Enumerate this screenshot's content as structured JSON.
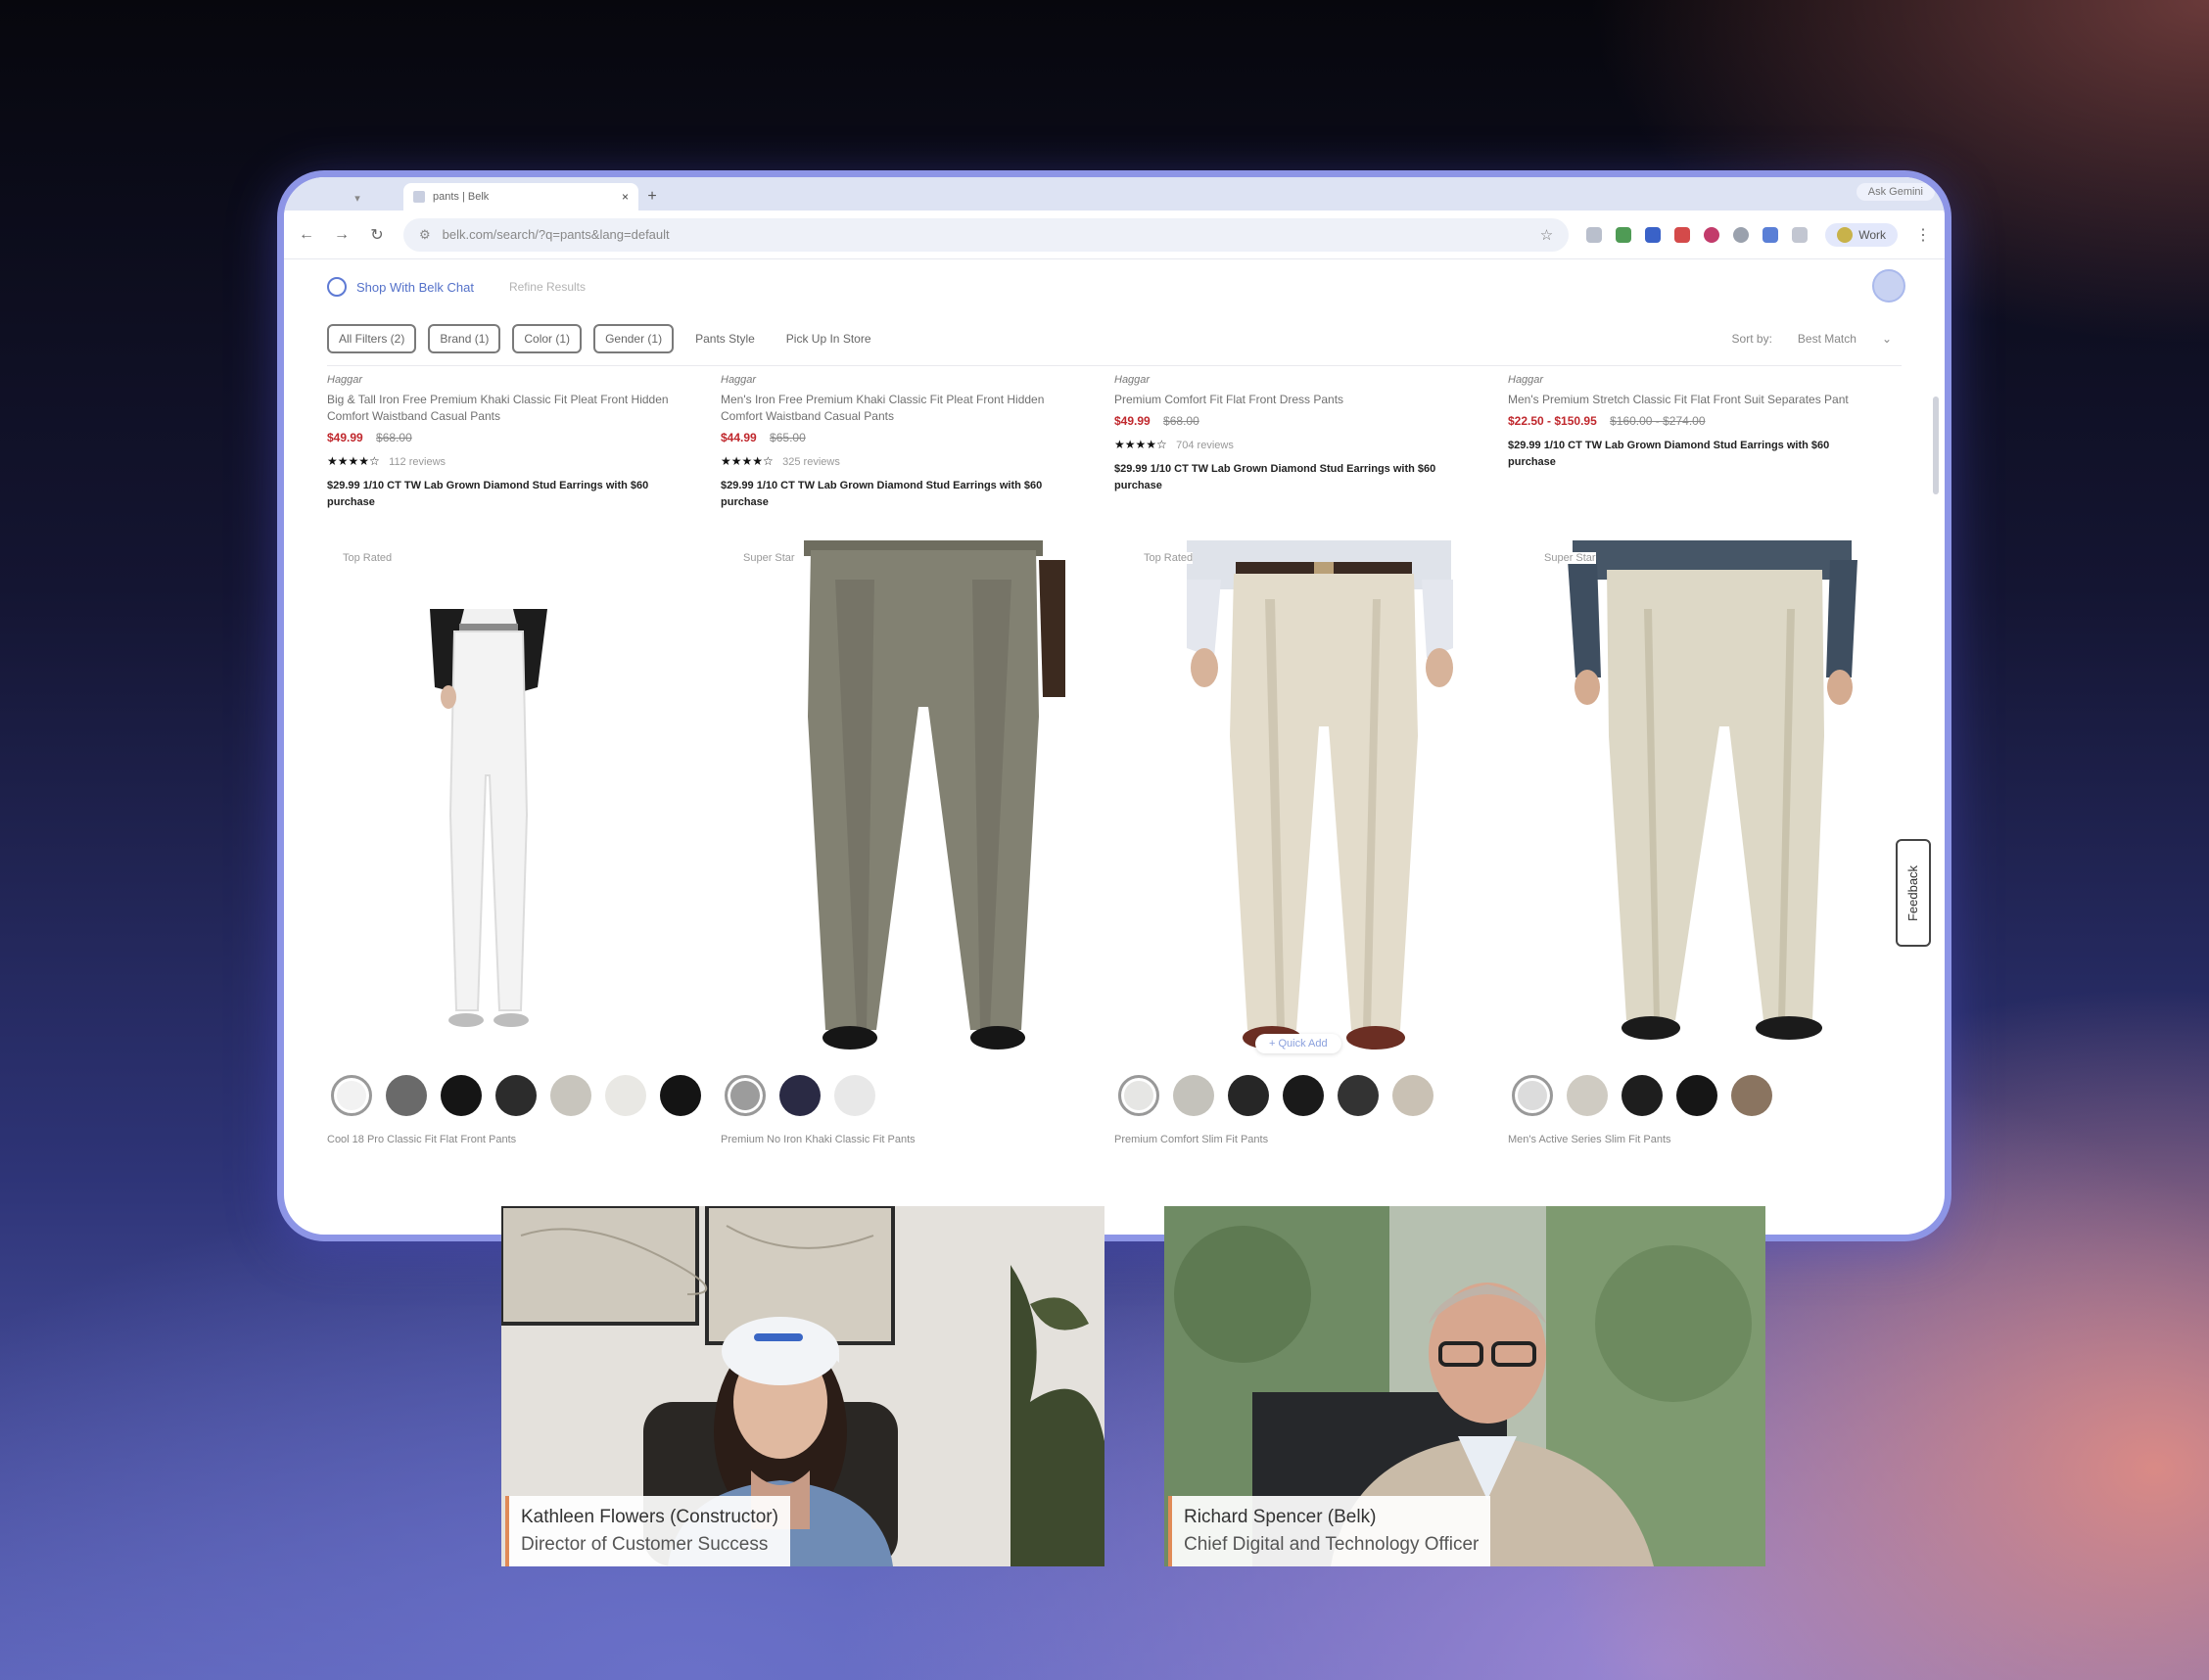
{
  "browser": {
    "tab_title": "pants | Belk",
    "tab_right": "Ask Gemini",
    "url": "belk.com/search/?q=pants&lang=default",
    "profile_label": "Work"
  },
  "page": {
    "shop_chat_label": "Shop With Belk Chat",
    "refine_label": "Refine Results",
    "filters": [
      "All Filters (2)",
      "Brand (1)",
      "Color (1)",
      "Gender (1)"
    ],
    "filters_plain": [
      "Pants Style",
      "Pick Up In Store"
    ],
    "sort_label": "Sort by:",
    "sort_value": "Best Match",
    "feedback_label": "Feedback"
  },
  "products": [
    {
      "brand": "Haggar",
      "name": "Big & Tall Iron Free Premium Khaki Classic Fit Pleat Front Hidden Comfort Waistband Casual Pants",
      "sale_price": "$49.99",
      "orig_price": "$68.00",
      "stars": "★★★★☆",
      "review_count": "112 reviews",
      "promo": "$29.99 1/10 CT TW Lab Grown Diamond Stud Earrings with $60 purchase",
      "badge": "Top Rated",
      "quick_add": "",
      "next_name": "Cool 18 Pro Classic Fit Flat Front Pants"
    },
    {
      "brand": "Haggar",
      "name": "Men's Iron Free Premium Khaki Classic Fit Pleat Front Hidden Comfort Waistband Casual Pants",
      "sale_price": "$44.99",
      "orig_price": "$65.00",
      "stars": "★★★★☆",
      "review_count": "325 reviews",
      "promo": "$29.99 1/10 CT TW Lab Grown Diamond Stud Earrings with $60 purchase",
      "badge": "Super Star",
      "quick_add": "",
      "next_name": "Premium No Iron Khaki Classic Fit Pants"
    },
    {
      "brand": "Haggar",
      "name": "Premium Comfort Fit Flat Front Dress Pants",
      "sale_price": "$49.99",
      "orig_price": "$68.00",
      "stars": "★★★★☆",
      "review_count": "704 reviews",
      "promo": "$29.99 1/10 CT TW Lab Grown Diamond Stud Earrings with $60 purchase",
      "badge": "Top Rated",
      "quick_add": "+ Quick Add",
      "next_name": "Premium Comfort Slim Fit Pants"
    },
    {
      "brand": "Haggar",
      "name": "Men's Premium Stretch Classic Fit Flat Front Suit Separates Pant",
      "sale_price": "$22.50 - $150.95",
      "orig_price": "",
      "was_price": "$160.00 - $274.00",
      "stars": "",
      "review_count": "",
      "promo": "$29.99 1/10 CT TW Lab Grown Diamond Stud Earrings with $60 purchase",
      "badge": "Super Star",
      "quick_add": "",
      "next_name": "Men's Active Series Slim Fit Pants"
    }
  ],
  "swatch_colors": {
    "p1": [
      "#f2f2f2",
      "#6a6a6a",
      "#151515",
      "#2c2c2c",
      "#c8c5bd",
      "#e9e8e4",
      "#141414"
    ],
    "p2": [
      "#9c9c9c",
      "#2a2a44",
      "#e8e8e8"
    ],
    "p3": [
      "#e6e6e4",
      "#c4c2bb",
      "#262626",
      "#1a1a1a",
      "#333333",
      "#c9c1b4"
    ],
    "p4": [
      "#dcdcdc",
      "#cfcbc2",
      "#1e1e1e",
      "#161616",
      "#8a7460"
    ]
  },
  "participants": [
    {
      "name": "Kathleen Flowers (Constructor)",
      "role": "Director of Customer Success"
    },
    {
      "name": "Richard Spencer (Belk)",
      "role": "Chief Digital and Technology Officer"
    }
  ]
}
